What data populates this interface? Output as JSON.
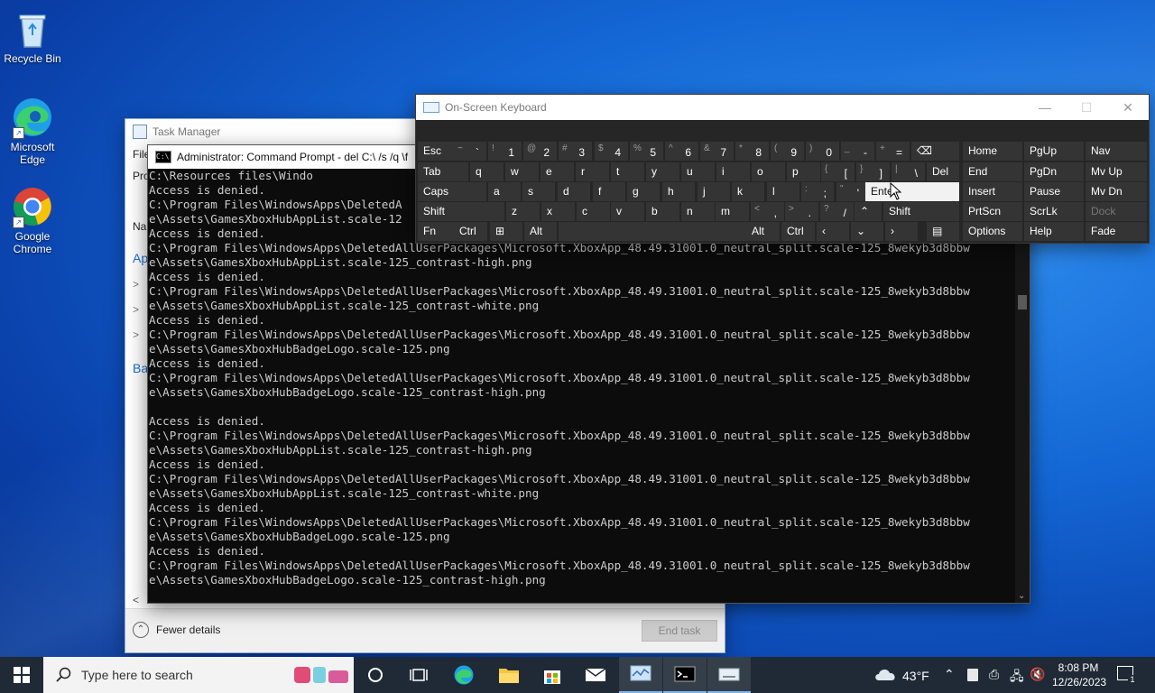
{
  "desktop": {
    "icons": [
      {
        "label": "Recycle Bin",
        "icon": "recycle-bin-icon"
      },
      {
        "label": "Microsoft Edge",
        "icon": "edge-icon"
      },
      {
        "label": "Google Chrome",
        "icon": "chrome-icon"
      }
    ]
  },
  "task_manager": {
    "title": "Task Manager",
    "side_fragments": [
      "File",
      "Pro",
      "Nar",
      "Ap",
      ">",
      ">",
      ">",
      "Ba"
    ],
    "fewer_details": "Fewer details",
    "end_task": "End task"
  },
  "cmd": {
    "title": "Administrator: Command Prompt - del  C:\\ /s /q \\f",
    "lines": [
      "C:\\Resources files\\Windo",
      "Access is denied.",
      "C:\\Program Files\\WindowsApps\\DeletedA",
      "e\\Assets\\GamesXboxHubAppList.scale-12",
      "Access is denied.",
      "C:\\Program Files\\WindowsApps\\DeletedAllUserPackages\\Microsoft.XboxApp_48.49.31001.0_neutral_split.scale-125_8wekyb3d8bbw",
      "e\\Assets\\GamesXboxHubAppList.scale-125_contrast-high.png",
      "Access is denied.",
      "C:\\Program Files\\WindowsApps\\DeletedAllUserPackages\\Microsoft.XboxApp_48.49.31001.0_neutral_split.scale-125_8wekyb3d8bbw",
      "e\\Assets\\GamesXboxHubAppList.scale-125_contrast-white.png",
      "Access is denied.",
      "C:\\Program Files\\WindowsApps\\DeletedAllUserPackages\\Microsoft.XboxApp_48.49.31001.0_neutral_split.scale-125_8wekyb3d8bbw",
      "e\\Assets\\GamesXboxHubBadgeLogo.scale-125.png",
      "Access is denied.",
      "C:\\Program Files\\WindowsApps\\DeletedAllUserPackages\\Microsoft.XboxApp_48.49.31001.0_neutral_split.scale-125_8wekyb3d8bbw",
      "e\\Assets\\GamesXboxHubBadgeLogo.scale-125_contrast-high.png",
      "",
      "Access is denied.",
      "C:\\Program Files\\WindowsApps\\DeletedAllUserPackages\\Microsoft.XboxApp_48.49.31001.0_neutral_split.scale-125_8wekyb3d8bbw",
      "e\\Assets\\GamesXboxHubAppList.scale-125_contrast-high.png",
      "Access is denied.",
      "C:\\Program Files\\WindowsApps\\DeletedAllUserPackages\\Microsoft.XboxApp_48.49.31001.0_neutral_split.scale-125_8wekyb3d8bbw",
      "e\\Assets\\GamesXboxHubAppList.scale-125_contrast-white.png",
      "Access is denied.",
      "C:\\Program Files\\WindowsApps\\DeletedAllUserPackages\\Microsoft.XboxApp_48.49.31001.0_neutral_split.scale-125_8wekyb3d8bbw",
      "e\\Assets\\GamesXboxHubBadgeLogo.scale-125.png",
      "Access is denied.",
      "C:\\Program Files\\WindowsApps\\DeletedAllUserPackages\\Microsoft.XboxApp_48.49.31001.0_neutral_split.scale-125_8wekyb3d8bbw",
      "e\\Assets\\GamesXboxHubBadgeLogo.scale-125_contrast-high.png"
    ]
  },
  "osk": {
    "title": "On-Screen Keyboard",
    "hot_key": "Enter",
    "rows": [
      [
        {
          "id": "esc",
          "label": "Esc"
        },
        {
          "id": "backtick",
          "shift": "~",
          "main": "`"
        },
        {
          "id": "1",
          "shift": "!",
          "main": "1"
        },
        {
          "id": "2",
          "shift": "@",
          "main": "2"
        },
        {
          "id": "3",
          "shift": "#",
          "main": "3"
        },
        {
          "id": "4",
          "shift": "$",
          "main": "4"
        },
        {
          "id": "5",
          "shift": "%",
          "main": "5"
        },
        {
          "id": "6",
          "shift": "^",
          "main": "6"
        },
        {
          "id": "7",
          "shift": "&",
          "main": "7"
        },
        {
          "id": "8",
          "shift": "*",
          "main": "8"
        },
        {
          "id": "9",
          "shift": "(",
          "main": "9"
        },
        {
          "id": "0",
          "shift": ")",
          "main": "0"
        },
        {
          "id": "minus",
          "shift": "_",
          "main": "-"
        },
        {
          "id": "equals",
          "shift": "+",
          "main": "="
        },
        {
          "id": "backspace",
          "label": "⌫"
        }
      ],
      [
        {
          "id": "tab",
          "label": "Tab"
        },
        {
          "id": "q",
          "label": "q"
        },
        {
          "id": "w",
          "label": "w"
        },
        {
          "id": "e",
          "label": "e"
        },
        {
          "id": "r",
          "label": "r"
        },
        {
          "id": "t",
          "label": "t"
        },
        {
          "id": "y",
          "label": "y"
        },
        {
          "id": "u",
          "label": "u"
        },
        {
          "id": "i",
          "label": "i"
        },
        {
          "id": "o",
          "label": "o"
        },
        {
          "id": "p",
          "label": "p"
        },
        {
          "id": "lbracket",
          "shift": "{",
          "main": "["
        },
        {
          "id": "rbracket",
          "shift": "}",
          "main": "]"
        },
        {
          "id": "backslash",
          "shift": "|",
          "main": "\\"
        },
        {
          "id": "del",
          "label": "Del"
        }
      ],
      [
        {
          "id": "caps",
          "label": "Caps"
        },
        {
          "id": "a",
          "label": "a"
        },
        {
          "id": "s",
          "label": "s"
        },
        {
          "id": "d",
          "label": "d"
        },
        {
          "id": "f",
          "label": "f"
        },
        {
          "id": "g",
          "label": "g"
        },
        {
          "id": "h",
          "label": "h"
        },
        {
          "id": "j",
          "label": "j"
        },
        {
          "id": "k",
          "label": "k"
        },
        {
          "id": "l",
          "label": "l"
        },
        {
          "id": "semicolon",
          "shift": ":",
          "main": ";"
        },
        {
          "id": "quote",
          "shift": "\"",
          "main": "'"
        },
        {
          "id": "enter",
          "label": "Enter"
        }
      ],
      [
        {
          "id": "lshift",
          "label": "Shift"
        },
        {
          "id": "z",
          "label": "z"
        },
        {
          "id": "x",
          "label": "x"
        },
        {
          "id": "c",
          "label": "c"
        },
        {
          "id": "v",
          "label": "v"
        },
        {
          "id": "b",
          "label": "b"
        },
        {
          "id": "n",
          "label": "n"
        },
        {
          "id": "m",
          "label": "m"
        },
        {
          "id": "comma",
          "shift": "<",
          "main": ","
        },
        {
          "id": "period",
          "shift": ">",
          "main": "."
        },
        {
          "id": "slash",
          "shift": "?",
          "main": "/"
        },
        {
          "id": "up",
          "label": "⌃"
        },
        {
          "id": "rshift",
          "label": "Shift"
        }
      ],
      [
        {
          "id": "fn",
          "label": "Fn"
        },
        {
          "id": "lctrl",
          "label": "Ctrl"
        },
        {
          "id": "win",
          "label": "⊞"
        },
        {
          "id": "lalt",
          "label": "Alt"
        },
        {
          "id": "space",
          "label": ""
        },
        {
          "id": "ralt",
          "label": "Alt"
        },
        {
          "id": "rctrl",
          "label": "Ctrl"
        },
        {
          "id": "left",
          "label": "‹"
        },
        {
          "id": "down",
          "label": "⌄"
        },
        {
          "id": "right",
          "label": "›"
        },
        {
          "id": "menu",
          "label": "▤"
        }
      ]
    ],
    "nav": [
      [
        "Home",
        "PgUp",
        "Nav"
      ],
      [
        "End",
        "PgDn",
        "Mv Up"
      ],
      [
        "Insert",
        "Pause",
        "Mv Dn"
      ],
      [
        "PrtScn",
        "ScrLk",
        "Dock"
      ],
      [
        "Options",
        "Help",
        "Fade"
      ]
    ]
  },
  "taskbar": {
    "search_placeholder": "Type here to search",
    "weather": "43°F",
    "time": "8:08 PM",
    "date": "12/26/2023",
    "notification_count": "1"
  },
  "colors": {
    "accent": "#0078d4",
    "taskbar": "#1f2a36",
    "console_bg": "#0c0c0c",
    "osk_bg": "#262626"
  }
}
